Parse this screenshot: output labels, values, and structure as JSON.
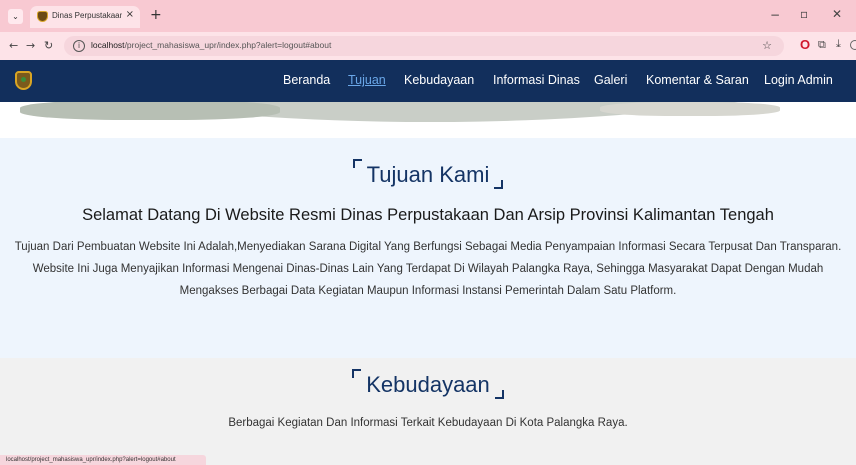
{
  "browser": {
    "tab_title": "Dinas Perpustakaan Dan Arsip K",
    "tab_close": "×",
    "new_tab": "+",
    "url_host": "localhost",
    "url_path": "/project_mahasiswa_upr/index.php?alert=logout#about",
    "status_url": "localhost/project_mahasiswa_upr/index.php?alert=logout#about"
  },
  "nav": {
    "items": [
      "Beranda",
      "Tujuan",
      "Kebudayaan",
      "Informasi Dinas",
      "Galeri",
      "Komentar & Saran",
      "Login Admin"
    ],
    "active": "Tujuan"
  },
  "tujuan": {
    "title": "Tujuan Kami",
    "welcome": "Selamat Datang Di Website Resmi Dinas Perpustakaan Dan Arsip Provinsi Kalimantan Tengah",
    "description": "Tujuan Dari Pembuatan Website Ini Adalah,Menyediakan Sarana Digital Yang Berfungsi Sebagai Media Penyampaian Informasi Secara Terpusat Dan Transparan. Website Ini Juga Menyajikan Informasi Mengenai Dinas-Dinas Lain Yang Terdapat Di Wilayah Palangka Raya, Sehingga Masyarakat Dapat Dengan Mudah Mengakses Berbagai Data Kegiatan Maupun Informasi Instansi Pemerintah Dalam Satu Platform."
  },
  "kebudayaan": {
    "title": "Kebudayaan",
    "description": "Berbagai Kegiatan Dan Informasi Terkait Kebudayaan Di Kota Palangka Raya."
  },
  "colors": {
    "header_bg": "#122f5c",
    "accent": "#143465",
    "active_link": "#6aa7e8",
    "browser_chrome": "#f8c9d2"
  }
}
